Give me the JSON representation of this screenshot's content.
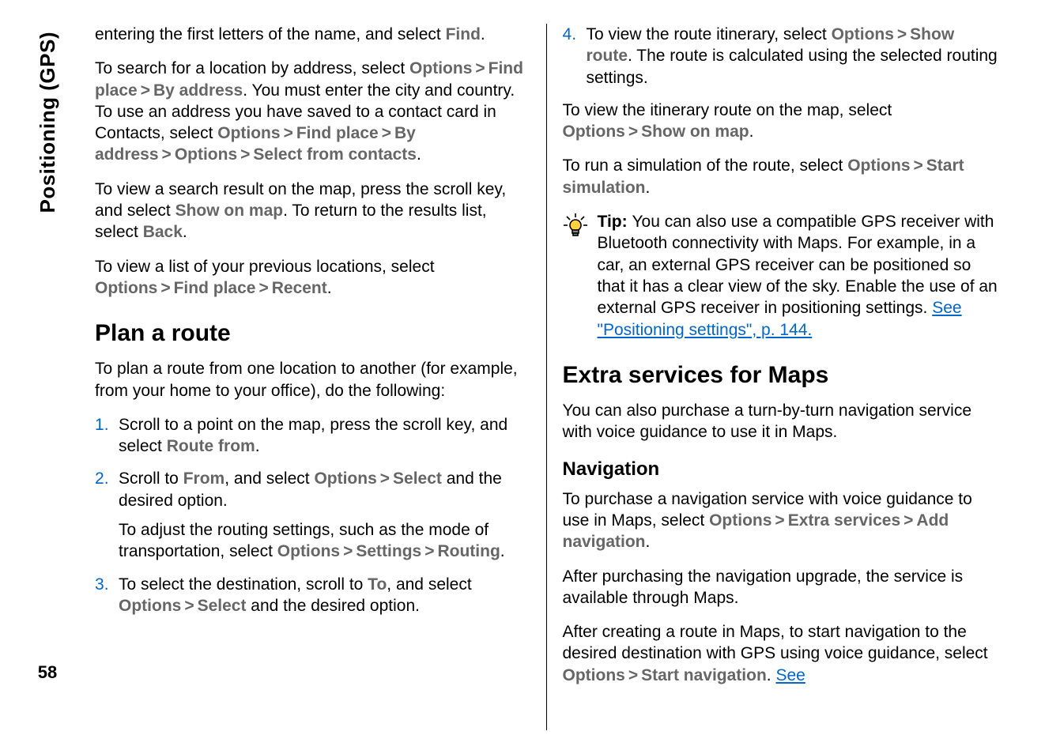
{
  "sidebar": {
    "section_label": "Positioning (GPS)",
    "page_number": "58"
  },
  "left": {
    "p1_a": "entering the first letters of the name, and select ",
    "p1_b": "Find",
    "p1_c": ".",
    "p2_a": "To search for a location by address, select ",
    "p2_b": "Options",
    "p2_c": "Find place",
    "p2_d": "By address",
    "p2_e": ". You must enter the city and country. To use an address you have saved to a contact card in Contacts, select ",
    "p2_f": "Options",
    "p2_g": "Find place",
    "p2_h": "By address",
    "p2_i": "Options",
    "p2_j": "Select from contacts",
    "p2_k": ".",
    "p3_a": "To view a search result on the map, press the scroll key, and select ",
    "p3_b": "Show on map",
    "p3_c": ". To return to the results list, select ",
    "p3_d": "Back",
    "p3_e": ".",
    "p4_a": "To view a list of your previous locations, select ",
    "p4_b": "Options",
    "p4_c": "Find place",
    "p4_d": "Recent",
    "p4_e": ".",
    "h2_plan": "Plan a route",
    "p5": "To plan a route from one location to another (for example, from your home to your office), do the following:",
    "li1_a": "Scroll to a point on the map, press the scroll key, and select ",
    "li1_b": "Route from",
    "li1_c": ".",
    "li2_a": "Scroll to ",
    "li2_b": "From",
    "li2_c": ", and select ",
    "li2_d": "Options",
    "li2_e": "Select",
    "li2_f": " and the desired option.",
    "li2p2_a": "To adjust the routing settings, such as the mode of transportation, select ",
    "li2p2_b": "Options",
    "li2p2_c": "Settings",
    "li2p2_d": "Routing",
    "li2p2_e": ".",
    "li3_a": "To select the destination, scroll to ",
    "li3_b": "To",
    "li3_c": ", and select ",
    "li3_d": "Options",
    "li3_e": "Select",
    "li3_f": " and the desired option."
  },
  "right": {
    "li4_a": "To view the route itinerary, select ",
    "li4_b": "Options",
    "li4_c": "Show route",
    "li4_d": ". The route is calculated using the selected routing settings.",
    "p6_a": "To view the itinerary route on the map, select ",
    "p6_b": "Options",
    "p6_c": "Show on map",
    "p6_d": ".",
    "p7_a": "To run a simulation of the route, select ",
    "p7_b": "Options",
    "p7_c": "Start simulation",
    "p7_d": ".",
    "tip_label": "Tip: ",
    "tip_text": "You can also use a compatible GPS receiver with Bluetooth connectivity with Maps. For example, in a car, an external GPS receiver can be positioned so that it has a clear view of the sky. Enable the use of an external GPS receiver in positioning settings. ",
    "tip_link": "See \"Positioning settings\", p. 144.",
    "h2_extra": "Extra services for Maps",
    "p8": "You can also purchase a turn-by-turn navigation service with voice guidance to use it in Maps.",
    "h3_nav": "Navigation",
    "p9_a": "To purchase a navigation service with voice guidance to use in Maps, select ",
    "p9_b": "Options",
    "p9_c": "Extra services",
    "p9_d": "Add navigation",
    "p9_e": ".",
    "p10": "After purchasing the navigation upgrade, the service is available through Maps.",
    "p11_a": "After creating a route in Maps, to start navigation to the desired destination with GPS using voice guidance, select ",
    "p11_b": "Options",
    "p11_c": "Start navigation",
    "p11_d": ". ",
    "p11_link": "See"
  },
  "gt": ">"
}
